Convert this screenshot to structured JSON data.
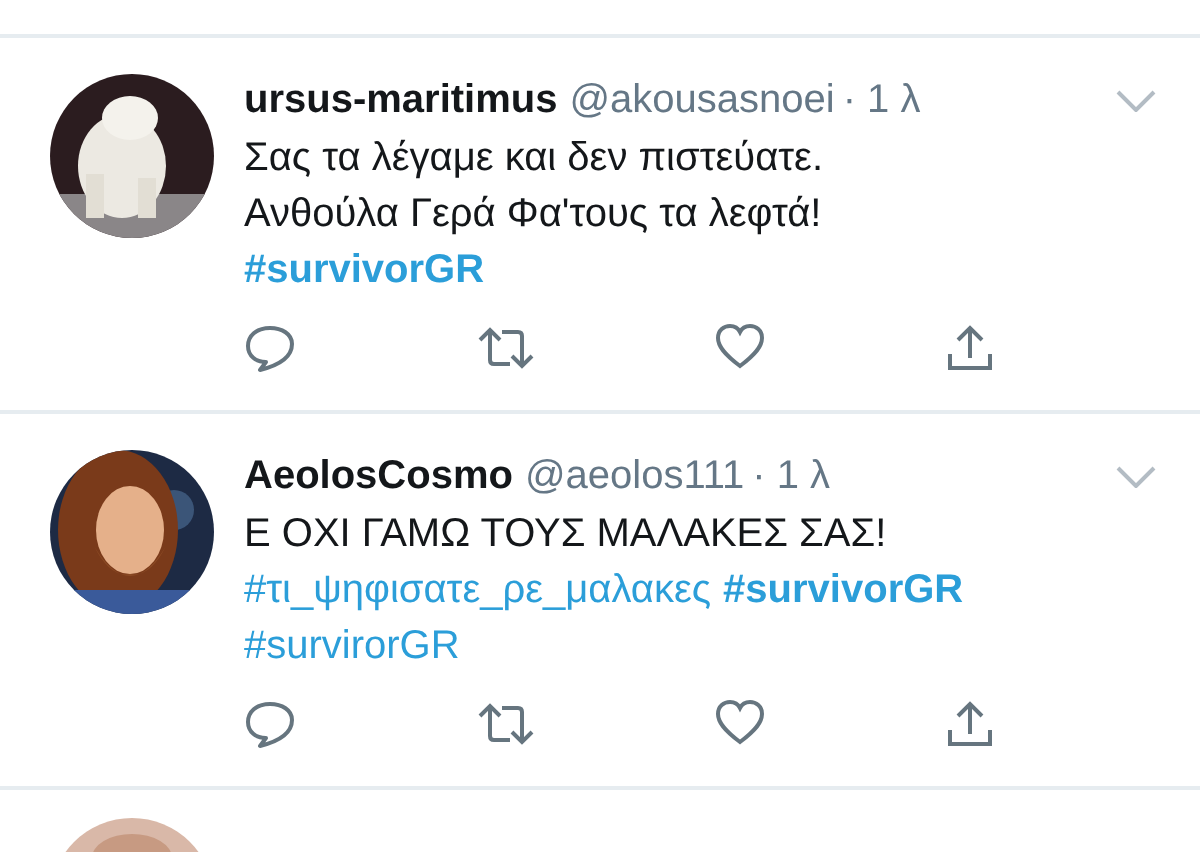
{
  "tweets": [
    {
      "name": "ursus-maritimus",
      "handle": "@akousasnoei",
      "time": "· 1 λ",
      "lines": [
        [
          {
            "kind": "text",
            "text": "Σας τα λέγαμε και δεν πιστεύατε."
          }
        ],
        [
          {
            "kind": "text",
            "text": "Ανθούλα Γερά Φα'τους τα λεφτά!"
          }
        ],
        [
          {
            "kind": "hashtag",
            "text": "#survivorGR",
            "bold": true
          }
        ]
      ]
    },
    {
      "name": "AeolosCosmo",
      "handle": "@aeolos111",
      "time": "· 1 λ",
      "lines": [
        [
          {
            "kind": "text",
            "text": "Ε ΟΧΙ ΓΑΜΩ ΤΟΥΣ ΜΑΛΑΚΕΣ ΣΑΣ!"
          }
        ],
        [
          {
            "kind": "hashtag",
            "text": "#τι_ψηφισατε_ρε_μαλακες",
            "bold": false
          },
          {
            "kind": "hashtag",
            "text": "#survivorGR",
            "bold": true
          }
        ],
        [
          {
            "kind": "hashtag",
            "text": "#survirorGR",
            "bold": false
          }
        ]
      ]
    }
  ]
}
